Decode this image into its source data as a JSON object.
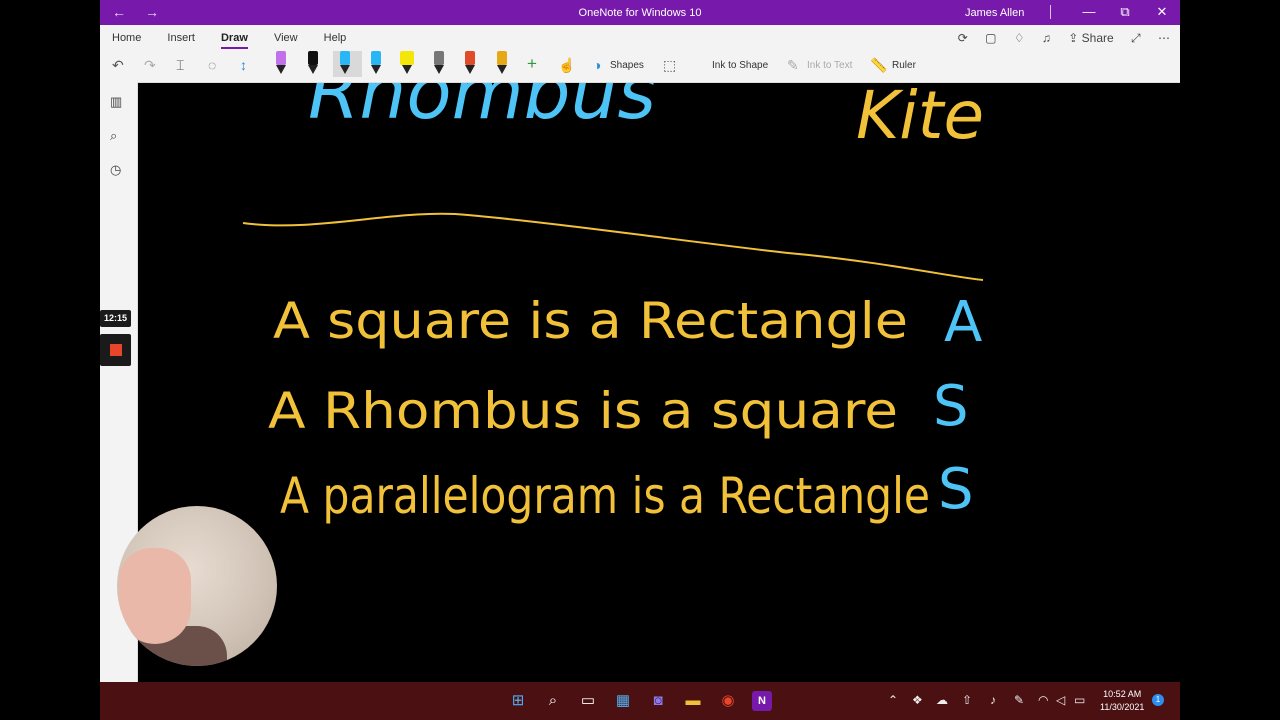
{
  "window": {
    "title": "OneNote for Windows 10",
    "user": "James Allen",
    "back": "←",
    "forward": "→",
    "minimize": "—",
    "maximize": "⧉",
    "close": "✕"
  },
  "ribbon": {
    "tabs": [
      "Home",
      "Insert",
      "Draw",
      "View",
      "Help"
    ],
    "active_tab": "Draw",
    "share_label": "Share",
    "tools": {
      "shapes": "Shapes",
      "ink_to_shape": "Ink to Shape",
      "ink_to_text": "Ink to Text",
      "ruler": "Ruler",
      "add_pen": "+"
    },
    "pen_colors": [
      "#c070e8",
      "#111111",
      "#29b6f6",
      "#29b6f6",
      "#f5e60a",
      "#777777",
      "#e04b2a",
      "#e6a814"
    ]
  },
  "recording": {
    "timer": "12:15"
  },
  "ink": {
    "heading_left": "Rhombus",
    "heading_right": "Kite",
    "statements": [
      {
        "text": "A square is a Rectangle",
        "answer": "A"
      },
      {
        "text": "A Rhombus is a square",
        "answer": "S"
      },
      {
        "text": "A parallelogram is a Rectangle",
        "answer": "S"
      }
    ],
    "colors": {
      "statement": "#f2c13a",
      "answer": "#4ec3f5",
      "heading_left": "#4ec3f5",
      "heading_right": "#f2c13a"
    }
  },
  "taskbar": {
    "time": "10:52 AM",
    "date": "11/30/2021",
    "notifications": "1"
  }
}
